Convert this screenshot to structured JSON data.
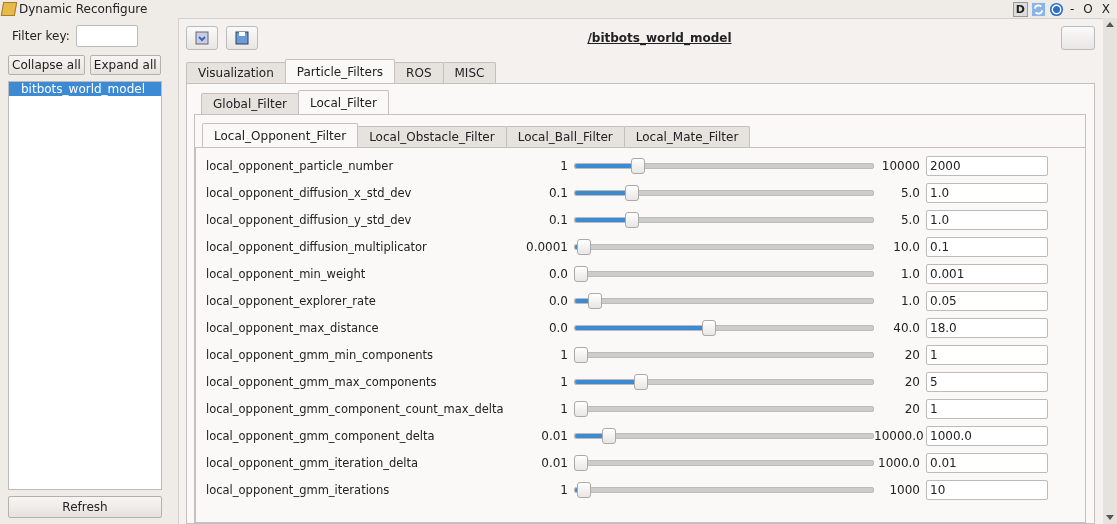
{
  "window": {
    "title": "Dynamic Reconfigure",
    "title_buttons": [
      "D",
      "-",
      "O",
      "X"
    ]
  },
  "sidebar": {
    "filter_label": "Filter key:",
    "collapse_button": "Collapse all",
    "expand_button": "Expand all",
    "items": [
      {
        "label": "bitbots_world_model",
        "selected": true
      }
    ],
    "refresh_button": "Refresh"
  },
  "node_title": "/bitbots_world_model",
  "tabs": [
    {
      "label": "Visualization",
      "selected": false
    },
    {
      "label": "Particle_Filters",
      "selected": true
    },
    {
      "label": "ROS",
      "selected": false
    },
    {
      "label": "MISC",
      "selected": false
    }
  ],
  "subtabs": [
    {
      "label": "Global_Filter",
      "selected": false
    },
    {
      "label": "Local_Filter",
      "selected": true
    }
  ],
  "filter_tabs": [
    {
      "label": "Local_Opponent_Filter",
      "selected": true
    },
    {
      "label": "Local_Obstacle_Filter",
      "selected": false
    },
    {
      "label": "Local_Ball_Filter",
      "selected": false
    },
    {
      "label": "Local_Mate_Filter",
      "selected": false
    }
  ],
  "params": [
    {
      "name": "local_opponent_particle_number",
      "min": "1",
      "max": "10000",
      "value": "2000",
      "level": 0.2
    },
    {
      "name": "local_opponent_diffusion_x_std_dev",
      "min": "0.1",
      "max": "5.0",
      "value": "1.0",
      "level": 0.18
    },
    {
      "name": "local_opponent_diffusion_y_std_dev",
      "min": "0.1",
      "max": "5.0",
      "value": "1.0",
      "level": 0.18
    },
    {
      "name": "local_opponent_diffusion_multiplicator",
      "min": "0.0001",
      "max": "10.0",
      "value": "0.1",
      "level": 0.01
    },
    {
      "name": "local_opponent_min_weight",
      "min": "0.0",
      "max": "1.0",
      "value": "0.001",
      "level": 0.0
    },
    {
      "name": "local_opponent_explorer_rate",
      "min": "0.0",
      "max": "1.0",
      "value": "0.05",
      "level": 0.05
    },
    {
      "name": "local_opponent_max_distance",
      "min": "0.0",
      "max": "40.0",
      "value": "18.0",
      "level": 0.45
    },
    {
      "name": "local_opponent_gmm_min_components",
      "min": "1",
      "max": "20",
      "value": "1",
      "level": 0.0
    },
    {
      "name": "local_opponent_gmm_max_components",
      "min": "1",
      "max": "20",
      "value": "5",
      "level": 0.21
    },
    {
      "name": "local_opponent_gmm_component_count_max_delta",
      "min": "1",
      "max": "20",
      "value": "1",
      "level": 0.0
    },
    {
      "name": "local_opponent_gmm_component_delta",
      "min": "0.01",
      "max": "10000.0",
      "value": "1000.0",
      "level": 0.1
    },
    {
      "name": "local_opponent_gmm_iteration_delta",
      "min": "0.01",
      "max": "1000.0",
      "value": "0.01",
      "level": 0.0
    },
    {
      "name": "local_opponent_gmm_iterations",
      "min": "1",
      "max": "1000",
      "value": "10",
      "level": 0.01
    }
  ]
}
